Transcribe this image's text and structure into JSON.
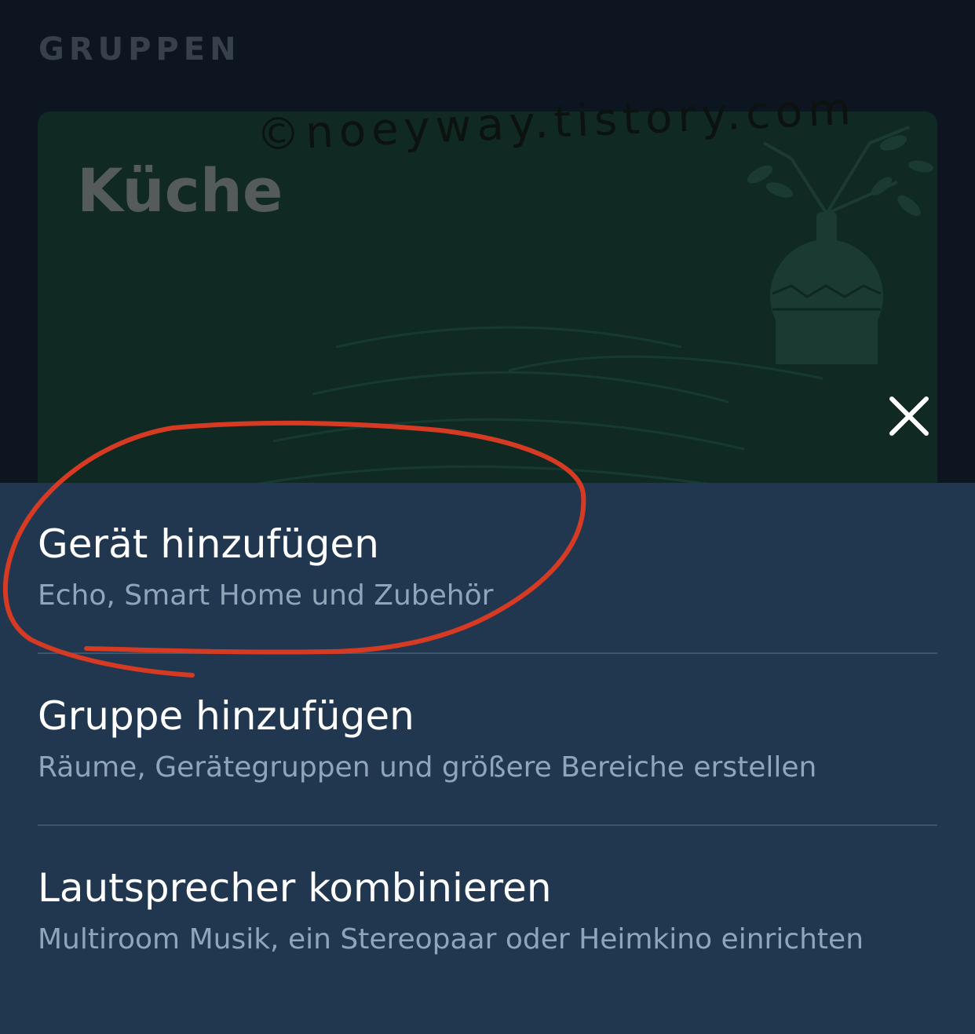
{
  "section": {
    "title": "GRUPPEN"
  },
  "group_card": {
    "title": "Küche",
    "watermark": "©noeyway.tistory.com"
  },
  "close": {
    "icon": "close-icon"
  },
  "menu": {
    "items": [
      {
        "title": "Gerät hinzufügen",
        "subtitle": "Echo, Smart Home und Zubehör"
      },
      {
        "title": "Gruppe hinzufügen",
        "subtitle": "Räume, Gerätegruppen und größere Bereiche erstellen"
      },
      {
        "title": "Lautsprecher kombinieren",
        "subtitle": "Multiroom Musik, ein Stereopaar oder Heimkino einrichten"
      }
    ]
  },
  "colors": {
    "background": "#0d1520",
    "sheet": "#213750",
    "card": "#102a23",
    "annotation": "#d63a22",
    "subtitle": "#8fa5b9"
  }
}
